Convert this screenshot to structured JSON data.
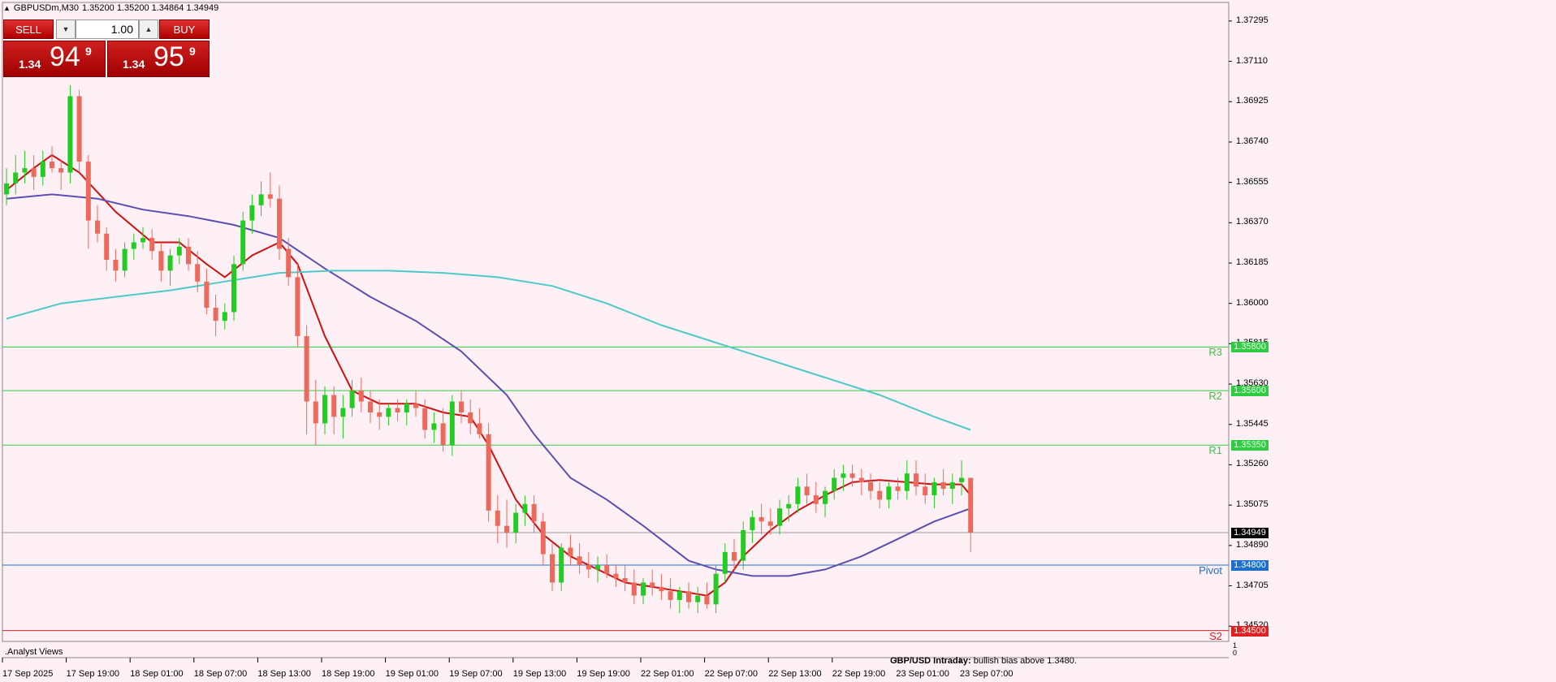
{
  "header": {
    "symbol": "GBPUSDm,M30",
    "ohlc": "1.35200 1.35200 1.34864 1.34949"
  },
  "trade_panel": {
    "sell_label": "SELL",
    "buy_label": "BUY",
    "lot": "1.00",
    "sell_prefix": "1.34",
    "sell_big": "94",
    "sell_sup": "9",
    "buy_prefix": "1.34",
    "buy_big": "95",
    "buy_sup": "9"
  },
  "price_axis": [
    "1.37295",
    "1.37110",
    "1.36925",
    "1.36740",
    "1.36555",
    "1.36370",
    "1.36185",
    "1.36000",
    "1.35815",
    "1.35630",
    "1.35445",
    "1.35260",
    "1.35075",
    "1.34890",
    "1.34705",
    "1.34520"
  ],
  "levels": [
    {
      "name": "R3",
      "price": 1.358,
      "tag": "1.35800",
      "color": "#2ecc40",
      "label_color": "#40c040"
    },
    {
      "name": "R2",
      "price": 1.356,
      "tag": "1.35600",
      "color": "#2ecc40",
      "label_color": "#40c040"
    },
    {
      "name": "R1",
      "price": 1.3535,
      "tag": "1.35350",
      "color": "#2ecc40",
      "label_color": "#40c040"
    },
    {
      "name": "Pivot",
      "price": 1.348,
      "tag": "1.34800",
      "color": "#1a6fd1",
      "label_color": "#1a6fd1"
    },
    {
      "name": "S2",
      "price": 1.345,
      "tag": "1.34500",
      "color": "#e02020",
      "label_color": "#e02020"
    }
  ],
  "current_price": {
    "value": 1.34949,
    "tag": "1.34949"
  },
  "time_axis": [
    "17 Sep 2025",
    "17 Sep 19:00",
    "18 Sep 01:00",
    "18 Sep 07:00",
    "18 Sep 13:00",
    "18 Sep 19:00",
    "19 Sep 01:00",
    "19 Sep 07:00",
    "19 Sep 13:00",
    "19 Sep 19:00",
    "22 Sep 01:00",
    "22 Sep 07:00",
    "22 Sep 13:00",
    "22 Sep 19:00",
    "23 Sep 01:00",
    "23 Sep 07:00"
  ],
  "footer": {
    "analyst": ".Analyst Views",
    "ticker_bold": "GBP/USD Intraday:",
    "ticker_text": "bullish bias above 1.3480."
  },
  "volume_scale": [
    "1",
    "0"
  ],
  "colors": {
    "up": "#22cc22",
    "down": "#ec6a5c",
    "ma_fast": "#cc1111",
    "ma_mid": "#5a4fb0",
    "ma_slow": "#4ec9c9",
    "background": "#fff0f5"
  },
  "chart_data": {
    "type": "candlestick",
    "symbol": "GBPUSDm",
    "timeframe": "M30",
    "ylim": [
      1.3445,
      1.3738
    ],
    "candles": [
      [
        1.365,
        1.3662,
        1.3645,
        1.3655
      ],
      [
        1.3655,
        1.3668,
        1.365,
        1.366
      ],
      [
        1.366,
        1.367,
        1.3655,
        1.3662
      ],
      [
        1.3662,
        1.3668,
        1.3652,
        1.3658
      ],
      [
        1.3658,
        1.367,
        1.3654,
        1.3665
      ],
      [
        1.3665,
        1.3672,
        1.366,
        1.3662
      ],
      [
        1.3662,
        1.3666,
        1.3652,
        1.366
      ],
      [
        1.366,
        1.37,
        1.3655,
        1.3695
      ],
      [
        1.3695,
        1.3698,
        1.366,
        1.3665
      ],
      [
        1.3665,
        1.3668,
        1.3625,
        1.3638
      ],
      [
        1.3638,
        1.3645,
        1.3628,
        1.3632
      ],
      [
        1.3632,
        1.3635,
        1.3615,
        1.362
      ],
      [
        1.362,
        1.3625,
        1.361,
        1.3615
      ],
      [
        1.3615,
        1.3628,
        1.3612,
        1.3625
      ],
      [
        1.3625,
        1.3632,
        1.362,
        1.3628
      ],
      [
        1.3628,
        1.3635,
        1.3625,
        1.363
      ],
      [
        1.363,
        1.3634,
        1.362,
        1.3624
      ],
      [
        1.3624,
        1.3628,
        1.361,
        1.3615
      ],
      [
        1.3615,
        1.3625,
        1.3608,
        1.3622
      ],
      [
        1.3622,
        1.363,
        1.3618,
        1.3626
      ],
      [
        1.3626,
        1.363,
        1.3615,
        1.3618
      ],
      [
        1.3618,
        1.3624,
        1.3605,
        1.361
      ],
      [
        1.361,
        1.3616,
        1.3595,
        1.3598
      ],
      [
        1.3598,
        1.3604,
        1.3585,
        1.3592
      ],
      [
        1.3592,
        1.36,
        1.3588,
        1.3596
      ],
      [
        1.3596,
        1.3622,
        1.3592,
        1.3618
      ],
      [
        1.3618,
        1.3642,
        1.3615,
        1.3638
      ],
      [
        1.3638,
        1.365,
        1.3632,
        1.3645
      ],
      [
        1.3645,
        1.3656,
        1.364,
        1.365
      ],
      [
        1.365,
        1.366,
        1.3644,
        1.3648
      ],
      [
        1.3648,
        1.3654,
        1.362,
        1.3625
      ],
      [
        1.3625,
        1.363,
        1.3608,
        1.3612
      ],
      [
        1.3612,
        1.3618,
        1.358,
        1.3585
      ],
      [
        1.3585,
        1.359,
        1.354,
        1.3555
      ],
      [
        1.3555,
        1.3565,
        1.3535,
        1.3545
      ],
      [
        1.3545,
        1.3562,
        1.354,
        1.3558
      ],
      [
        1.3558,
        1.3562,
        1.354,
        1.3548
      ],
      [
        1.3548,
        1.3558,
        1.3538,
        1.3552
      ],
      [
        1.3552,
        1.3565,
        1.3548,
        1.356
      ],
      [
        1.356,
        1.3566,
        1.355,
        1.3555
      ],
      [
        1.3555,
        1.356,
        1.3545,
        1.355
      ],
      [
        1.355,
        1.3556,
        1.3542,
        1.3548
      ],
      [
        1.3548,
        1.3554,
        1.3544,
        1.3552
      ],
      [
        1.3552,
        1.3556,
        1.3546,
        1.355
      ],
      [
        1.355,
        1.3556,
        1.3544,
        1.3554
      ],
      [
        1.3554,
        1.356,
        1.3548,
        1.3552
      ],
      [
        1.3552,
        1.3556,
        1.3538,
        1.3542
      ],
      [
        1.3542,
        1.355,
        1.3536,
        1.3545
      ],
      [
        1.3545,
        1.3552,
        1.3532,
        1.3535
      ],
      [
        1.3535,
        1.3558,
        1.353,
        1.3555
      ],
      [
        1.3555,
        1.356,
        1.3545,
        1.355
      ],
      [
        1.355,
        1.3556,
        1.354,
        1.3545
      ],
      [
        1.3545,
        1.3552,
        1.3538,
        1.354
      ],
      [
        1.354,
        1.3545,
        1.35,
        1.3505
      ],
      [
        1.3505,
        1.3512,
        1.349,
        1.3498
      ],
      [
        1.3498,
        1.351,
        1.3488,
        1.3495
      ],
      [
        1.3495,
        1.3508,
        1.349,
        1.3504
      ],
      [
        1.3504,
        1.3512,
        1.3498,
        1.3508
      ],
      [
        1.3508,
        1.3512,
        1.3495,
        1.35
      ],
      [
        1.35,
        1.3504,
        1.348,
        1.3485
      ],
      [
        1.3485,
        1.349,
        1.3468,
        1.3472
      ],
      [
        1.3472,
        1.349,
        1.3468,
        1.3488
      ],
      [
        1.3488,
        1.3494,
        1.348,
        1.3484
      ],
      [
        1.3484,
        1.349,
        1.3476,
        1.348
      ],
      [
        1.348,
        1.3486,
        1.3474,
        1.3478
      ],
      [
        1.3478,
        1.3484,
        1.3472,
        1.348
      ],
      [
        1.348,
        1.3485,
        1.3474,
        1.3476
      ],
      [
        1.3476,
        1.348,
        1.347,
        1.3474
      ],
      [
        1.3474,
        1.348,
        1.3468,
        1.3472
      ],
      [
        1.3472,
        1.3478,
        1.3462,
        1.3466
      ],
      [
        1.3466,
        1.3474,
        1.3462,
        1.3472
      ],
      [
        1.3472,
        1.3478,
        1.3466,
        1.347
      ],
      [
        1.347,
        1.3476,
        1.3464,
        1.3468
      ],
      [
        1.3468,
        1.3474,
        1.346,
        1.3464
      ],
      [
        1.3464,
        1.347,
        1.3458,
        1.3468
      ],
      [
        1.3468,
        1.3472,
        1.346,
        1.3463
      ],
      [
        1.3463,
        1.347,
        1.3458,
        1.3466
      ],
      [
        1.3466,
        1.3472,
        1.346,
        1.3462
      ],
      [
        1.3462,
        1.348,
        1.3458,
        1.3476
      ],
      [
        1.3476,
        1.349,
        1.3472,
        1.3486
      ],
      [
        1.3486,
        1.3492,
        1.3478,
        1.3482
      ],
      [
        1.3482,
        1.35,
        1.3478,
        1.3496
      ],
      [
        1.3496,
        1.3505,
        1.349,
        1.3502
      ],
      [
        1.3502,
        1.3508,
        1.3494,
        1.35
      ],
      [
        1.35,
        1.3506,
        1.3494,
        1.3498
      ],
      [
        1.3498,
        1.351,
        1.3494,
        1.3506
      ],
      [
        1.3506,
        1.3512,
        1.35,
        1.3508
      ],
      [
        1.3508,
        1.352,
        1.3504,
        1.3516
      ],
      [
        1.3516,
        1.3522,
        1.3508,
        1.3512
      ],
      [
        1.3512,
        1.3518,
        1.3504,
        1.3508
      ],
      [
        1.3508,
        1.3516,
        1.3502,
        1.3514
      ],
      [
        1.3514,
        1.3524,
        1.351,
        1.352
      ],
      [
        1.352,
        1.3526,
        1.3514,
        1.3522
      ],
      [
        1.3522,
        1.3526,
        1.3516,
        1.352
      ],
      [
        1.352,
        1.3524,
        1.3512,
        1.3518
      ],
      [
        1.3518,
        1.3522,
        1.351,
        1.3514
      ],
      [
        1.3514,
        1.3518,
        1.3506,
        1.351
      ],
      [
        1.351,
        1.3518,
        1.3506,
        1.3516
      ],
      [
        1.3516,
        1.352,
        1.351,
        1.3514
      ],
      [
        1.3514,
        1.3528,
        1.351,
        1.3522
      ],
      [
        1.3522,
        1.3528,
        1.3512,
        1.3516
      ],
      [
        1.3516,
        1.3522,
        1.3508,
        1.3512
      ],
      [
        1.3512,
        1.352,
        1.3506,
        1.3518
      ],
      [
        1.3518,
        1.3524,
        1.3512,
        1.3515
      ],
      [
        1.3515,
        1.3522,
        1.3508,
        1.3518
      ],
      [
        1.3518,
        1.3528,
        1.3512,
        1.352
      ],
      [
        1.352,
        1.352,
        1.3486,
        1.3495
      ]
    ],
    "series": [
      {
        "name": "",
        "type": "ma",
        "color": "#cc1111",
        "points": [
          [
            0,
            1.3652
          ],
          [
            3,
            1.3662
          ],
          [
            5,
            1.3668
          ],
          [
            8,
            1.366
          ],
          [
            12,
            1.3642
          ],
          [
            16,
            1.3628
          ],
          [
            19,
            1.3628
          ],
          [
            22,
            1.3618
          ],
          [
            24,
            1.3612
          ],
          [
            27,
            1.3622
          ],
          [
            30,
            1.3628
          ],
          [
            32,
            1.3618
          ],
          [
            35,
            1.3585
          ],
          [
            38,
            1.356
          ],
          [
            41,
            1.3554
          ],
          [
            45,
            1.3554
          ],
          [
            48,
            1.355
          ],
          [
            51,
            1.3548
          ],
          [
            53,
            1.3535
          ],
          [
            56,
            1.351
          ],
          [
            59,
            1.3494
          ],
          [
            62,
            1.3484
          ],
          [
            65,
            1.3478
          ],
          [
            68,
            1.3472
          ],
          [
            71,
            1.347
          ],
          [
            74,
            1.3468
          ],
          [
            77,
            1.3466
          ],
          [
            79,
            1.3472
          ],
          [
            81,
            1.3484
          ],
          [
            84,
            1.3496
          ],
          [
            87,
            1.3505
          ],
          [
            90,
            1.3512
          ],
          [
            93,
            1.3518
          ],
          [
            96,
            1.3519
          ],
          [
            99,
            1.3518
          ],
          [
            102,
            1.3517
          ],
          [
            105,
            1.3517
          ],
          [
            106,
            1.3512
          ]
        ]
      },
      {
        "name": "",
        "type": "ma",
        "color": "#5a4fb0",
        "points": [
          [
            0,
            1.3648
          ],
          [
            5,
            1.365
          ],
          [
            10,
            1.3648
          ],
          [
            15,
            1.3643
          ],
          [
            20,
            1.364
          ],
          [
            25,
            1.3636
          ],
          [
            30,
            1.363
          ],
          [
            35,
            1.3616
          ],
          [
            40,
            1.3603
          ],
          [
            45,
            1.3592
          ],
          [
            50,
            1.3578
          ],
          [
            55,
            1.3558
          ],
          [
            58,
            1.354
          ],
          [
            62,
            1.352
          ],
          [
            66,
            1.351
          ],
          [
            70,
            1.3498
          ],
          [
            75,
            1.3482
          ],
          [
            78,
            1.3478
          ],
          [
            82,
            1.3475
          ],
          [
            86,
            1.3475
          ],
          [
            90,
            1.3478
          ],
          [
            94,
            1.3484
          ],
          [
            98,
            1.3492
          ],
          [
            102,
            1.35
          ],
          [
            106,
            1.3506
          ]
        ]
      },
      {
        "name": "",
        "type": "ma",
        "color": "#4ec9c9",
        "points": [
          [
            0,
            1.3593
          ],
          [
            6,
            1.36
          ],
          [
            12,
            1.3603
          ],
          [
            18,
            1.3606
          ],
          [
            24,
            1.361
          ],
          [
            30,
            1.3614
          ],
          [
            36,
            1.3615
          ],
          [
            42,
            1.3615
          ],
          [
            48,
            1.3614
          ],
          [
            54,
            1.3612
          ],
          [
            60,
            1.3608
          ],
          [
            66,
            1.36
          ],
          [
            72,
            1.359
          ],
          [
            78,
            1.3582
          ],
          [
            84,
            1.3574
          ],
          [
            90,
            1.3566
          ],
          [
            96,
            1.3558
          ],
          [
            102,
            1.3548
          ],
          [
            106,
            1.3542
          ]
        ]
      }
    ]
  }
}
